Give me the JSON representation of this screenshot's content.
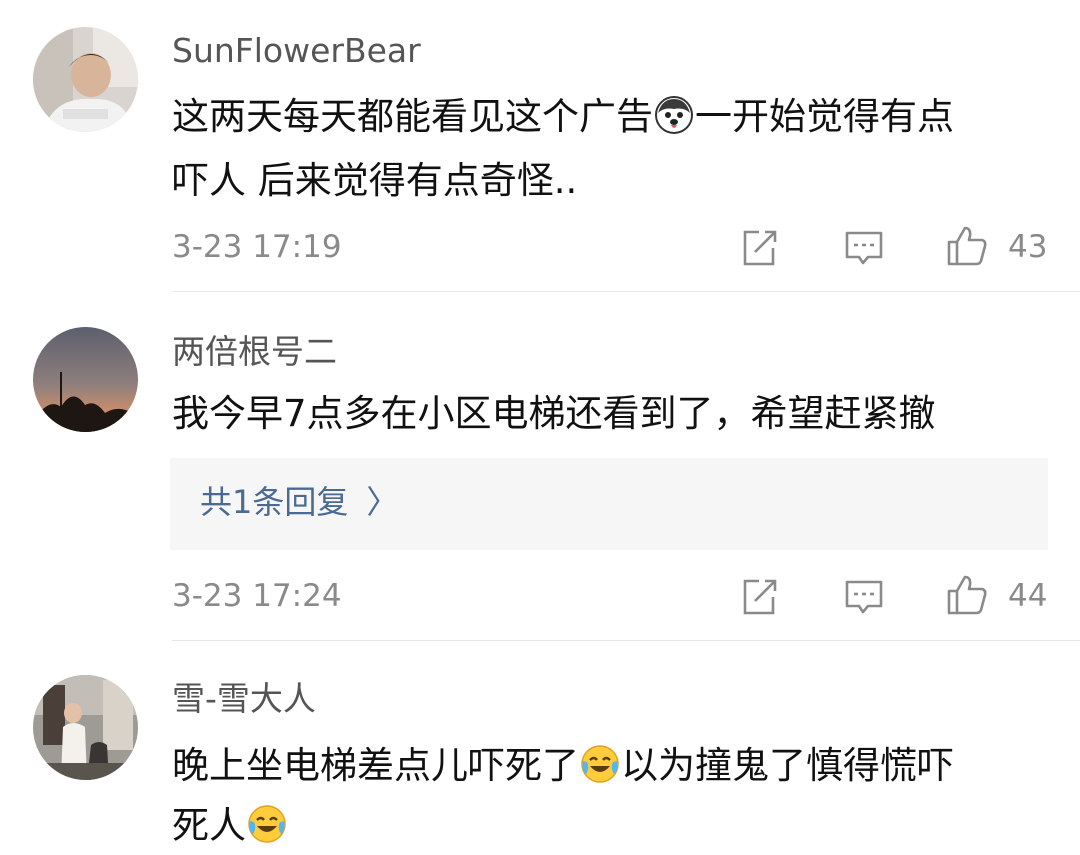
{
  "comments": [
    {
      "username": "SunFlowerBear",
      "text_line1_a": "这两天每天都能看见这个广告",
      "text_line1_emoji": "husky-emoji",
      "text_line1_b": "一开始觉得有点",
      "text_line2": "吓人 后来觉得有点奇怪..",
      "time": "3-23 17:19",
      "likes": "43"
    },
    {
      "username": "两倍根号二",
      "text_line1": "我今早7点多在小区电梯还看到了，希望赶紧撤",
      "reply_label": "共1条回复",
      "reply_chevron": "〉",
      "time": "3-23 17:24",
      "likes": "44"
    },
    {
      "username": "雪-雪大人",
      "text_line1_a": "晚上坐电梯差点儿吓死了",
      "text_line1_emoji": "laugh-cry-emoji",
      "text_line1_b": "以为撞鬼了慎得慌吓",
      "text_line2_a": "死人",
      "text_line2_emoji": "laugh-cry-emoji"
    }
  ],
  "icons": {
    "share": "share-icon",
    "comment": "comment-icon",
    "like": "like-icon"
  },
  "colors": {
    "reply_link": "#4a6a92",
    "meta": "#8a8a8a"
  }
}
